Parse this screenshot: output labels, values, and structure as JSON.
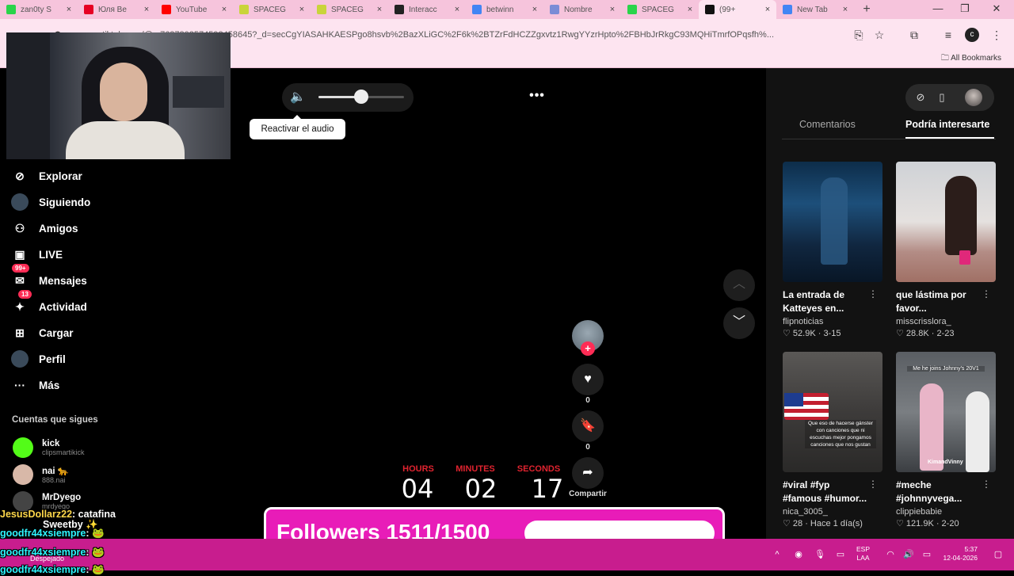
{
  "browser": {
    "tabs": [
      {
        "title": "zan0ty S",
        "color": "#2ad44a"
      },
      {
        "title": "Юля Ве",
        "color": "#e60023"
      },
      {
        "title": "YouTube",
        "color": "#ff0000"
      },
      {
        "title": "SPACEG",
        "color": "#c9d43a"
      },
      {
        "title": "SPACEG",
        "color": "#c9d43a"
      },
      {
        "title": "Interacc",
        "color": "#222222"
      },
      {
        "title": "betwinn",
        "color": "#4285f4"
      },
      {
        "title": "Nombre",
        "color": "#7b8cd6"
      },
      {
        "title": "SPACEG",
        "color": "#2ad44a"
      },
      {
        "title": "(99+",
        "color": "#111111",
        "active": true
      },
      {
        "title": "New Tab",
        "color": "#4285f4"
      }
    ],
    "url": "...tiktok.com/@...7627802574598458645?_d=secCgYIASAHKAESPgo8hsvb%2BazXLiGC%2F6k%2BTZrFdHCZZgxvtz1RwgYYzrHpto%2FBHbJrRkgC93MQHiTmrfOPqsfh%...",
    "bookmarks_label": "All Bookmarks",
    "profile_initial": "c"
  },
  "sidebar": {
    "nav": [
      {
        "label": "Explorar",
        "icon": "compass-icon",
        "glyph": "⊘"
      },
      {
        "label": "Siguiendo",
        "icon": "following-avatar-icon",
        "glyph": "●"
      },
      {
        "label": "Amigos",
        "icon": "friends-icon",
        "glyph": "⚇"
      },
      {
        "label": "LIVE",
        "icon": "live-tv-icon",
        "glyph": "▣"
      },
      {
        "label": "Mensajes",
        "icon": "messages-icon",
        "glyph": "✉",
        "badge": "99+"
      },
      {
        "label": "Actividad",
        "icon": "activity-icon",
        "glyph": "✦",
        "badge": "13"
      },
      {
        "label": "Cargar",
        "icon": "upload-icon",
        "glyph": "⊞"
      },
      {
        "label": "Perfil",
        "icon": "profile-avatar-icon",
        "glyph": "●"
      },
      {
        "label": "Más",
        "icon": "more-icon",
        "glyph": "···"
      }
    ],
    "following_title": "Cuentas que sigues",
    "accounts": [
      {
        "name": "kick",
        "handle": "clipsmartikick",
        "color": "#53fc18"
      },
      {
        "name": "nai 🐆",
        "handle": "888.nai",
        "color": "#d8b8a8"
      },
      {
        "name": "MrDyego",
        "handle": "mrdyego",
        "color": "#444"
      }
    ]
  },
  "player": {
    "tooltip": "Reactivar el audio",
    "volume_fraction": 0.5,
    "more_label": "•••",
    "likes": "0",
    "saves": "0",
    "share_label": "Compartir"
  },
  "countdown": {
    "labels": [
      "HOURS",
      "MINUTES",
      "SECONDS"
    ],
    "values": [
      "04",
      "02",
      "17"
    ]
  },
  "right_panel": {
    "tabs": [
      "Comentarios",
      "Podría interesarte"
    ],
    "active_tab": "Podría interesarte",
    "cards": [
      {
        "caption": "La entrada de Katteyes en...",
        "author": "flipnoticias",
        "meta": "♡ 52.9K · 3-15",
        "thumb": "stage"
      },
      {
        "caption": "que lástima por favor...",
        "author": "misscrisslora_",
        "meta": "♡ 28.8K · 2-23",
        "thumb": "room"
      },
      {
        "caption": "#viral #fyp #famous #humor...",
        "author": "nica_3005_",
        "meta": "♡ 28 · Hace 1 día(s)",
        "thumb": "flag",
        "overlay": "Que eso de hacerse gánster con canciones que ni escuchas mejor pongamos canciones que nos gustan"
      },
      {
        "caption": "#meche #johnnyvega...",
        "author": "clippiebabie",
        "meta": "♡ 121.9K · 2-20",
        "thumb": "stage2",
        "overlay": "Me he joins Johnny's 20V1",
        "watermark": "KimandVinny"
      }
    ]
  },
  "goal": {
    "text": "Followers 1511/1500",
    "current": 1511,
    "target": 1500
  },
  "chat": [
    {
      "user": "JesusDollarz22",
      "message": ": catafina",
      "ucls": "u2"
    },
    {
      "user": "",
      "message": "Sweetby ✨",
      "ucls": "u"
    },
    {
      "user": "goodfr44xsiempre",
      "message": ": 🐸",
      "ucls": "u"
    },
    {
      "user": "goodfr44xsiempre",
      "message": ": 🐸",
      "ucls": "u"
    },
    {
      "user": "goodfr44xsiempre",
      "message": ": 🐸",
      "ucls": "u"
    }
  ],
  "taskbar": {
    "weather": "Despejado",
    "lang_line1": "ESP",
    "lang_line2": "LAA",
    "time": "5:37",
    "date": "12-04-2026"
  }
}
